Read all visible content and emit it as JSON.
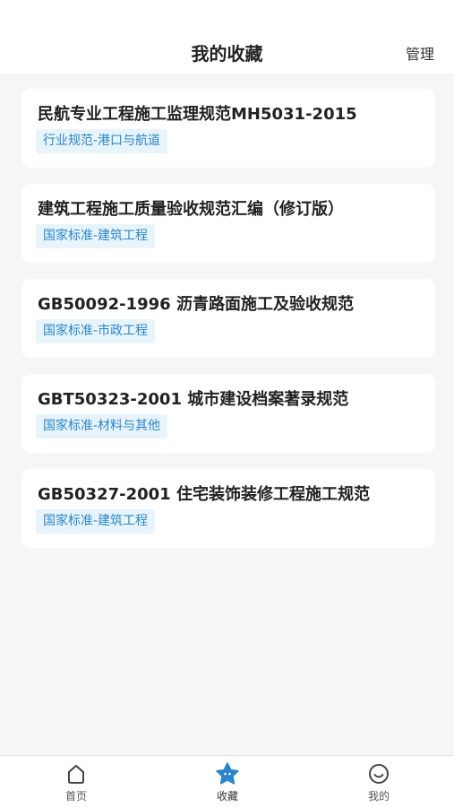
{
  "header": {
    "title": "我的收藏",
    "manage_label": "管理"
  },
  "favorites": [
    {
      "title": "民航专业工程施工监理规范MH5031-2015",
      "tag": "行业规范-港口与航道"
    },
    {
      "title": "建筑工程施工质量验收规范汇编（修订版）",
      "tag": "国家标准-建筑工程"
    },
    {
      "title": "GB50092-1996 沥青路面施工及验收规范",
      "tag": "国家标准-市政工程"
    },
    {
      "title": "GBT50323-2001 城市建设档案著录规范",
      "tag": "国家标准-材料与其他"
    },
    {
      "title": "GB50327-2001 住宅装饰装修工程施工规范",
      "tag": "国家标准-建筑工程"
    }
  ],
  "tabbar": {
    "home": {
      "label": "首页",
      "icon": "home-icon"
    },
    "favorites": {
      "label": "收藏",
      "icon": "star-icon"
    },
    "mine": {
      "label": "我的",
      "icon": "smile-icon"
    }
  },
  "colors": {
    "accent": "#2a86c8",
    "tag_bg": "#e8f4fb",
    "page_bg": "#f6f6f7"
  }
}
